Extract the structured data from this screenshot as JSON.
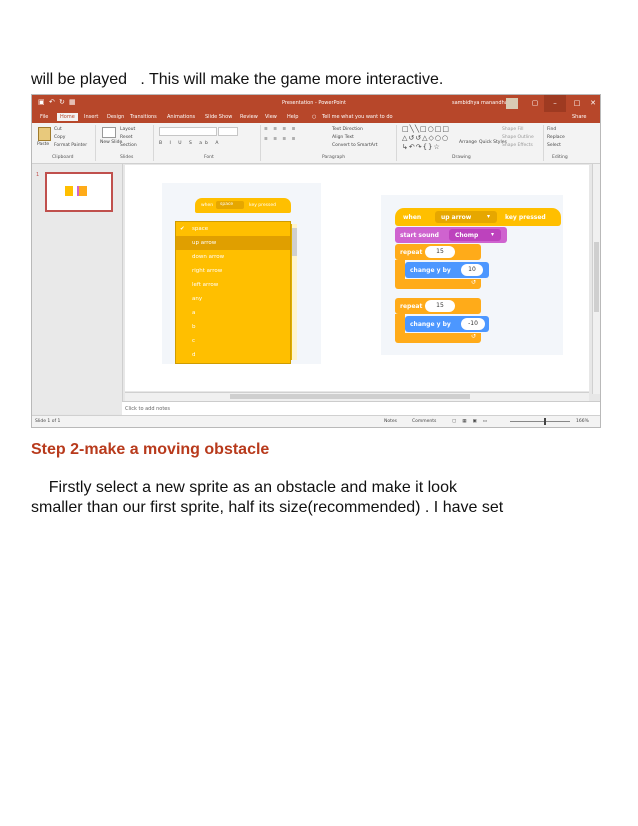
{
  "doc": {
    "line_top": "will be played   . This will make the game more interactive.",
    "heading": "Step 2-make a moving obstacle",
    "para_line1": "    Firstly select a new sprite as an obstacle and make it look",
    "para_line2": "smaller than our first sprite, half its size(recommended) . I have set"
  },
  "window": {
    "title": "Presentation - PowerPoint",
    "user": "sambidhya manandhar",
    "qat_icons": [
      "save-icon",
      "undo-icon",
      "redo-icon",
      "present-icon"
    ]
  },
  "menu": {
    "tabs": [
      "File",
      "Home",
      "Insert",
      "Design",
      "Transitions",
      "Animations",
      "Slide Show",
      "Review",
      "View",
      "Help"
    ],
    "tell_me": "Tell me what you want to do",
    "share": "Share"
  },
  "ribbon": {
    "paste": "Paste",
    "cut": "Cut",
    "copy": "Copy",
    "format_painter": "Format Painter",
    "new_slide": "New Slide",
    "layout": "Layout",
    "reset": "Reset",
    "section": "Section",
    "text_direction": "Text Direction",
    "align_text": "Align Text",
    "convert_smartart": "Convert to SmartArt",
    "arrange": "Arrange",
    "quick_styles": "Quick Styles",
    "shape_fill": "Shape Fill",
    "shape_outline": "Shape Outline",
    "shape_effects": "Shape Effects",
    "find": "Find",
    "replace": "Replace",
    "select": "Select",
    "groups": [
      "Clipboard",
      "Slides",
      "Font",
      "Paragraph",
      "Drawing",
      "Editing"
    ]
  },
  "slide_pane": {
    "number": "1"
  },
  "notes": {
    "placeholder": "Click to add notes"
  },
  "status": {
    "slide_of": "Slide 1 of 1",
    "notes_btn": "Notes",
    "comments_btn": "Comments",
    "zoom": "166%"
  },
  "scratch_left": {
    "hat_when": "when",
    "hat_key": "space",
    "hat_rest": "key pressed",
    "options": [
      "space",
      "up arrow",
      "down arrow",
      "right arrow",
      "left arrow",
      "any",
      "a",
      "b",
      "c",
      "d"
    ],
    "checked_index": 0,
    "highlight_index": 1
  },
  "scratch_right": {
    "when": "when",
    "key": "up arrow",
    "key_pressed": "key pressed",
    "start_sound": "start sound",
    "sound": "Chomp",
    "repeat1": "repeat",
    "repeat1_val": "15",
    "change1": "change y by",
    "change1_val": "10",
    "repeat2": "repeat",
    "repeat2_val": "15",
    "change2": "change y by",
    "change2_val": "-10",
    "colors": {
      "events": "#ffbf00",
      "sound": "#cf63cf",
      "control": "#ffab19",
      "motion": "#4c97ff"
    }
  }
}
